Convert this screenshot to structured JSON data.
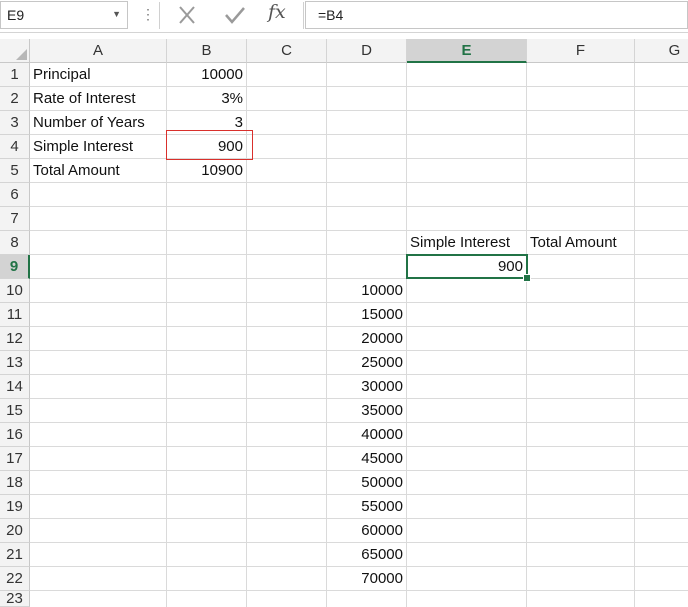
{
  "formula_bar": {
    "name_box": "E9",
    "formula": "=B4"
  },
  "columns": [
    "A",
    "B",
    "C",
    "D",
    "E",
    "F",
    "G"
  ],
  "active_column": "E",
  "rows": [
    "1",
    "2",
    "3",
    "4",
    "5",
    "6",
    "7",
    "8",
    "9",
    "10",
    "11",
    "12",
    "13",
    "14",
    "15",
    "16",
    "17",
    "18",
    "19",
    "20",
    "21",
    "22",
    "23"
  ],
  "active_row": "9",
  "cells": {
    "A1": "Principal",
    "B1": "10000",
    "A2": "Rate of Interest",
    "B2": "3%",
    "A3": "Number of Years",
    "B3": "3",
    "A4": "Simple Interest",
    "B4": "900",
    "A5": "Total Amount",
    "B5": "10900",
    "E8": "Simple Interest",
    "F8": "Total Amount",
    "E9": "900",
    "D10": "10000",
    "D11": "15000",
    "D12": "20000",
    "D13": "25000",
    "D14": "30000",
    "D15": "35000",
    "D16": "40000",
    "D17": "45000",
    "D18": "50000",
    "D19": "55000",
    "D20": "60000",
    "D21": "65000",
    "D22": "70000"
  },
  "colors": {
    "selection": "#217346",
    "highlight_box": "#d9302c"
  }
}
